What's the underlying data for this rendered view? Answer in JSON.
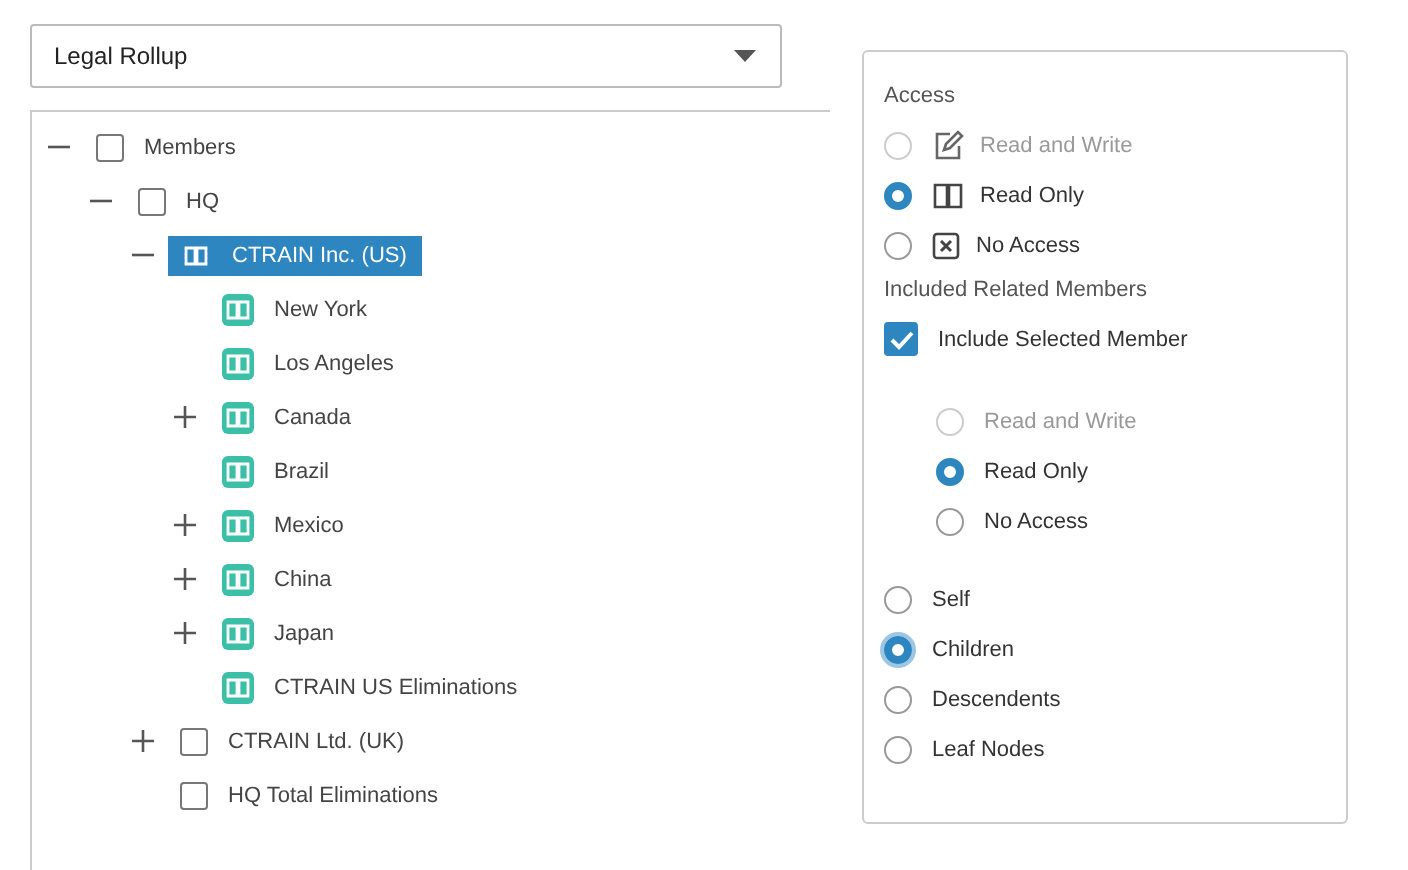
{
  "hierarchy_dropdown": {
    "value": "Legal Rollup"
  },
  "tree": [
    {
      "label": "Members",
      "kind": "checkbox",
      "checked": false,
      "selected": false,
      "expanded": true,
      "children": [
        {
          "label": "HQ",
          "kind": "checkbox",
          "checked": false,
          "selected": false,
          "expanded": true,
          "children": [
            {
              "label": "CTRAIN Inc. (US)",
              "kind": "member",
              "selected": true,
              "expanded": true,
              "children": [
                {
                  "label": "New York",
                  "kind": "member",
                  "selected": false
                },
                {
                  "label": "Los Angeles",
                  "kind": "member",
                  "selected": false
                },
                {
                  "label": "Canada",
                  "kind": "member",
                  "selected": false,
                  "expanded": false
                },
                {
                  "label": "Brazil",
                  "kind": "member",
                  "selected": false
                },
                {
                  "label": "Mexico",
                  "kind": "member",
                  "selected": false,
                  "expanded": false
                },
                {
                  "label": "China",
                  "kind": "member",
                  "selected": false,
                  "expanded": false
                },
                {
                  "label": "Japan",
                  "kind": "member",
                  "selected": false,
                  "expanded": false
                },
                {
                  "label": "CTRAIN US Eliminations",
                  "kind": "member",
                  "selected": false
                }
              ]
            },
            {
              "label": "CTRAIN Ltd. (UK)",
              "kind": "checkbox",
              "checked": false,
              "selected": false,
              "expanded": false
            },
            {
              "label": "HQ Total Eliminations",
              "kind": "checkbox",
              "checked": false,
              "selected": false
            }
          ]
        }
      ]
    }
  ],
  "access": {
    "heading": "Access",
    "options": [
      {
        "label": "Read and Write",
        "kind": "read_write",
        "selected": false,
        "disabled": true
      },
      {
        "label": "Read Only",
        "kind": "read_only",
        "selected": true,
        "disabled": false
      },
      {
        "label": "No Access",
        "kind": "no_access",
        "selected": false,
        "disabled": false
      }
    ]
  },
  "related": {
    "heading": "Included Related Members",
    "include_selected": {
      "label": "Include Selected Member",
      "checked": true
    },
    "member_access": [
      {
        "label": "Read and Write",
        "selected": false,
        "disabled": true
      },
      {
        "label": "Read Only",
        "selected": true,
        "disabled": false
      },
      {
        "label": "No Access",
        "selected": false,
        "disabled": false
      }
    ],
    "scope": [
      {
        "label": "Self",
        "selected": false,
        "focused": false
      },
      {
        "label": "Children",
        "selected": true,
        "focused": true
      },
      {
        "label": "Descendents",
        "selected": false,
        "focused": false
      },
      {
        "label": "Leaf Nodes",
        "selected": false,
        "focused": false
      }
    ]
  }
}
